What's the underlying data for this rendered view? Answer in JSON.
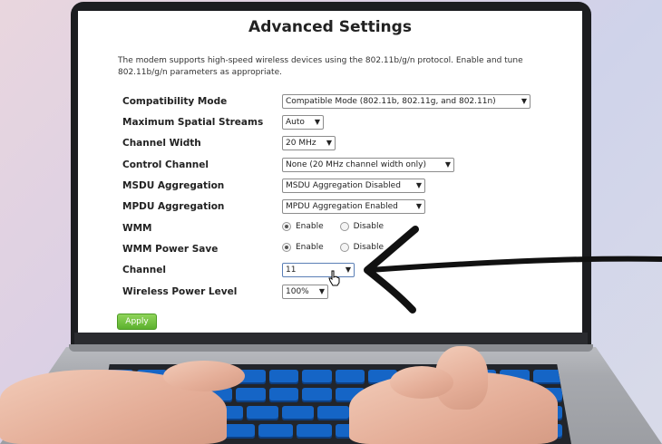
{
  "page": {
    "title": "Advanced Settings",
    "description": "The modem supports high-speed wireless devices using the 802.11b/g/n protocol. Enable and tune 802.11b/g/n parameters as appropriate."
  },
  "settings": [
    {
      "label": "Compatibility Mode",
      "type": "select",
      "value": "Compatible Mode (802.11b, 802.11g, and 802.11n)"
    },
    {
      "label": "Maximum Spatial Streams",
      "type": "select",
      "value": "Auto"
    },
    {
      "label": "Channel Width",
      "type": "select",
      "value": "20 MHz"
    },
    {
      "label": "Control Channel",
      "type": "select",
      "value": "None (20 MHz channel width only)"
    },
    {
      "label": "MSDU Aggregation",
      "type": "select",
      "value": "MSDU Aggregation Disabled"
    },
    {
      "label": "MPDU Aggregation",
      "type": "select",
      "value": "MPDU Aggregation Enabled"
    },
    {
      "label": "WMM",
      "type": "radio",
      "options": [
        "Enable",
        "Disable"
      ],
      "selected": "Enable"
    },
    {
      "label": "WMM Power Save",
      "type": "radio",
      "options": [
        "Enable",
        "Disable"
      ],
      "selected": "Enable"
    },
    {
      "label": "Channel",
      "type": "select",
      "value": "11"
    },
    {
      "label": "Wireless Power Level",
      "type": "select",
      "value": "100%"
    }
  ],
  "apply_label": "Apply",
  "dropdown_arrow": "▼",
  "icons": {
    "pointer": "hand-pointer-icon",
    "annotation": "hand-drawn-arrow-icon"
  },
  "colors": {
    "apply_button": "#5cb12e",
    "keyboard_keys": "#1565c6",
    "annotation_arrow": "#111111"
  }
}
